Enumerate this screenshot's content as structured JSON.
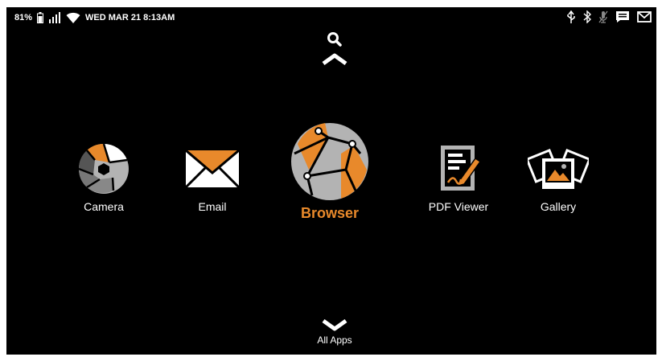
{
  "status_bar": {
    "battery_percent": "81%",
    "datetime": "WED MAR 21 8:13AM",
    "icons_left": [
      "battery-icon",
      "signal-icon",
      "wifi-icon"
    ],
    "icons_right": [
      "usb-icon",
      "bluetooth-icon",
      "microphone-icon",
      "message-icon",
      "gmail-icon"
    ]
  },
  "top": {
    "icons": [
      "search-icon",
      "chevron-up-icon"
    ]
  },
  "dock": {
    "items": [
      {
        "label": "Camera",
        "icon": "camera-aperture-icon"
      },
      {
        "label": "Email",
        "icon": "email-envelope-icon"
      },
      {
        "label": "Browser",
        "icon": "browser-globe-icon",
        "selected": true
      },
      {
        "label": "PDF Viewer",
        "icon": "pdf-document-icon"
      },
      {
        "label": "Gallery",
        "icon": "gallery-photos-icon"
      }
    ]
  },
  "bottom": {
    "all_apps_label": "All Apps",
    "icon": "chevron-down-icon"
  },
  "colors": {
    "background": "#000000",
    "accent": "#e8892b",
    "icon_gray": "#b3b3b3",
    "text": "#ffffff"
  }
}
